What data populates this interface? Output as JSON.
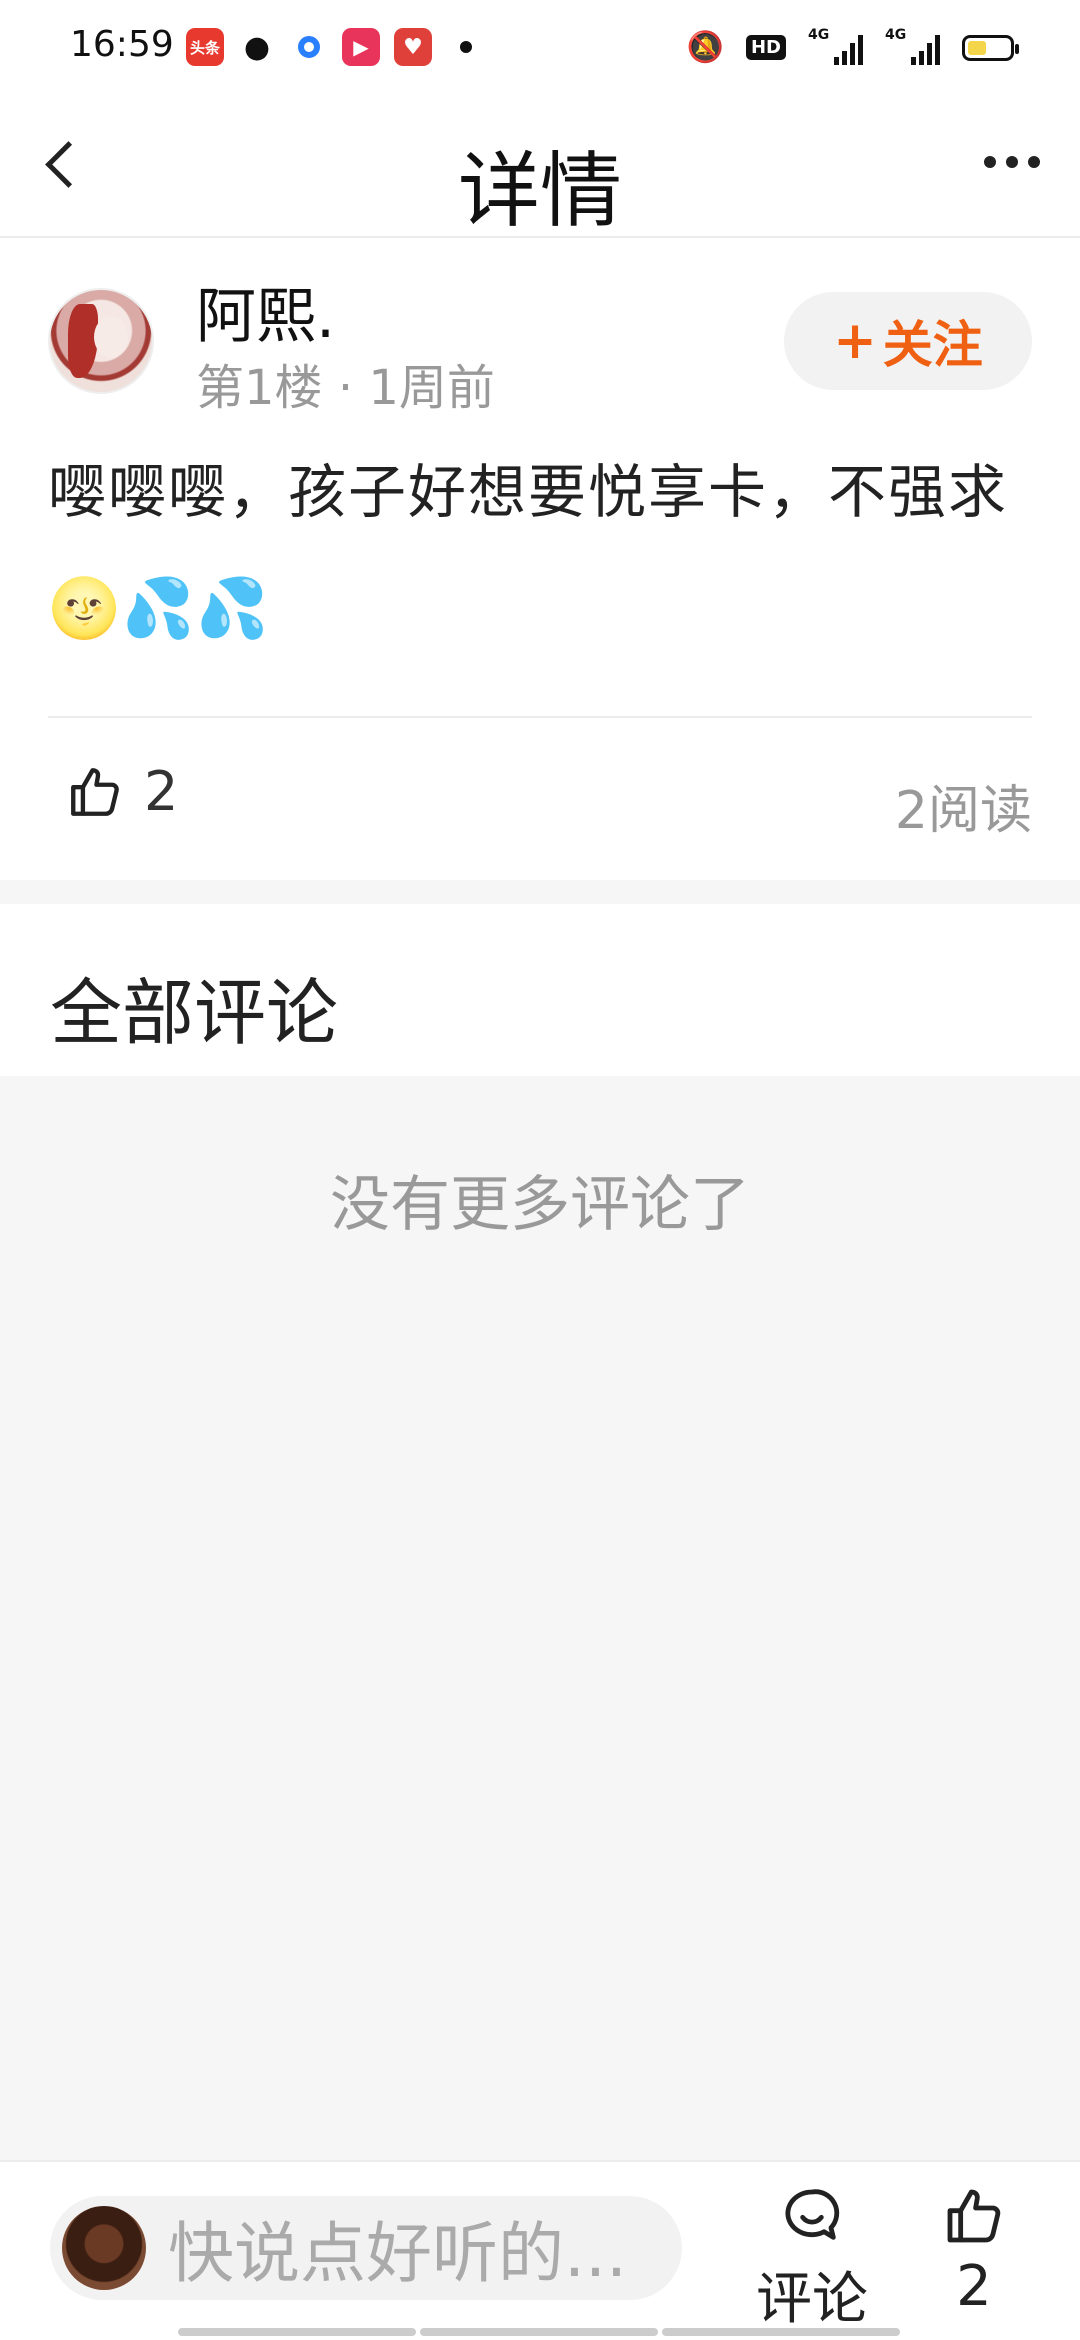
{
  "status_bar": {
    "time": "16:59",
    "apps": [
      "toutiao-icon",
      "wechat-icon",
      "blue-circle-icon",
      "video-icon",
      "heart-icon"
    ],
    "toutiao_label": "头条",
    "hd_label": "HD",
    "network_1": "4G",
    "network_2": "4G",
    "battery_level": 0.45
  },
  "nav": {
    "title": "详情"
  },
  "post": {
    "username": "阿熙.",
    "floor": "第1楼",
    "time_ago": "1周前",
    "meta_separator": "·",
    "follow_label": "关注",
    "follow_plus": "+",
    "content": "嘤嘤嘤，孩子好想要悦享卡，不强求🌝💦💦",
    "like_count": "2",
    "read_count": "2阅读"
  },
  "comments": {
    "title": "全部评论",
    "empty_text": "没有更多评论了"
  },
  "bottom_bar": {
    "input_placeholder": "快说点好听的...",
    "comment_label": "评论",
    "like_count": "2"
  },
  "colors": {
    "accent": "#f06012",
    "background": "#f6f6f6",
    "card": "#ffffff",
    "muted_text": "#999999"
  }
}
